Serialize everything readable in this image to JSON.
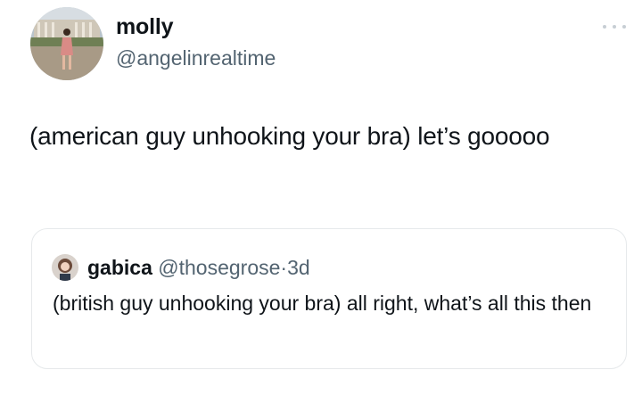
{
  "tweet": {
    "author": {
      "display_name": "molly",
      "handle": "@angelinrealtime",
      "avatar": "profile-photo"
    },
    "more_icon": "more-horizontal-icon",
    "text": "(american guy unhooking your bra) let’s gooooo"
  },
  "quoted_tweet": {
    "author": {
      "display_name": "gabica",
      "handle": "@thosegrose",
      "avatar": "profile-photo"
    },
    "separator": "·",
    "time": "3d",
    "text": "(british guy unhooking your bra) all right, what’s all this then"
  },
  "colors": {
    "text_primary": "#0f1419",
    "text_secondary": "#536471",
    "border": "#e6e9eb",
    "background": "#ffffff"
  }
}
